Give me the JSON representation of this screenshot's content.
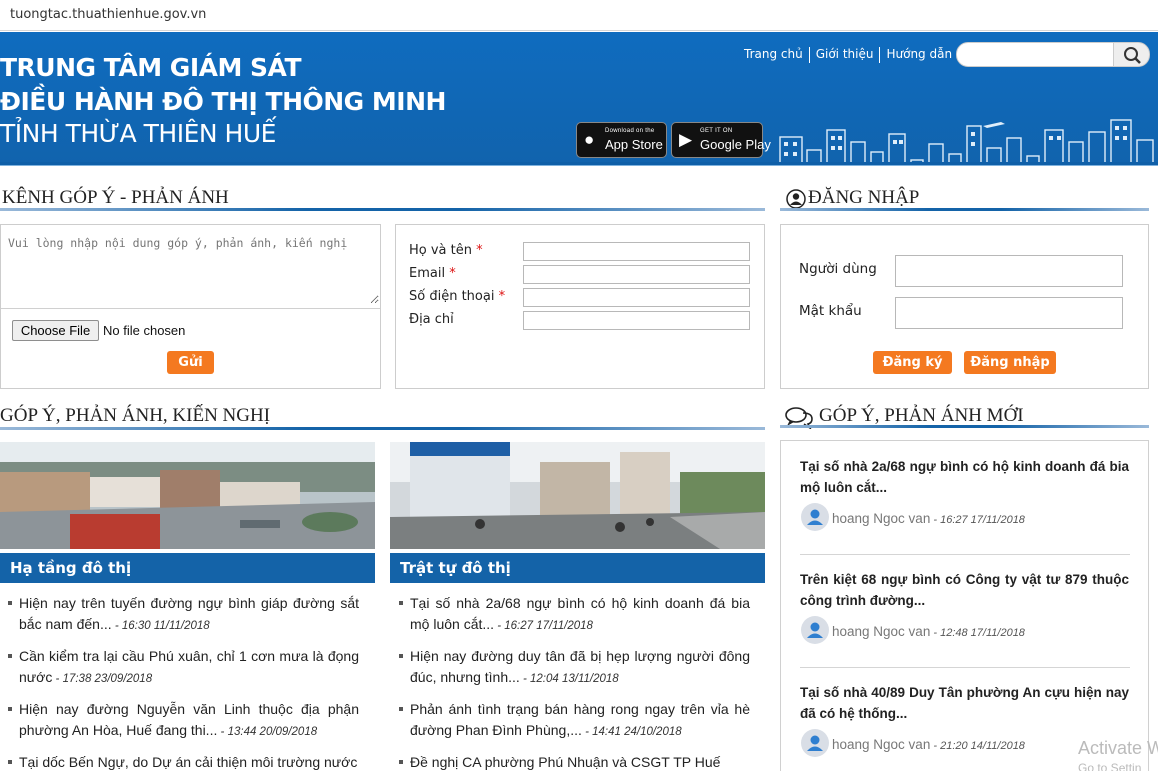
{
  "browser": {
    "url": "tuongtac.thuathienhue.gov.vn"
  },
  "header": {
    "title_line1": "TRUNG TÂM GIÁM SÁT",
    "title_line2": "ĐIỀU HÀNH ĐÔ THỊ THÔNG MINH",
    "title_line3": "TỈNH THỪA THIÊN HUẾ",
    "nav": [
      "Trang chủ",
      "Giới thiệu",
      "Hướng dẫn"
    ],
    "search_placeholder": "",
    "appstore_small": "Download on the",
    "appstore_big": "App Store",
    "gplay_small": "GET IT ON",
    "gplay_big": "Google Play"
  },
  "feedback": {
    "section_title": "KÊNH GÓP Ý - PHẢN ÁNH",
    "textarea_placeholder": "Vui lòng nhập nội dung góp ý, phản ánh, kiến nghị",
    "choose_file": "Choose File",
    "no_file": "No file chosen",
    "send": "Gửi",
    "fields": [
      {
        "label": "Họ và tên",
        "required": "*"
      },
      {
        "label": "Email",
        "required": "*"
      },
      {
        "label": "Số điện thoại",
        "required": "*"
      },
      {
        "label": "Địa chỉ",
        "required": ""
      }
    ]
  },
  "login": {
    "section_title": "ĐĂNG NHẬP",
    "user_label": "Người dùng",
    "pass_label": "Mật khẩu",
    "register": "Đăng ký",
    "login": "Đăng nhập"
  },
  "categories": {
    "section_title": "GÓP Ý, PHẢN ÁNH, KIẾN NGHỊ",
    "col1": {
      "title": "Hạ tầng đô thị",
      "items": [
        {
          "text": "Hiện nay trên tuyến đường ngự bình giáp đường sắt bắc nam đến...",
          "time": " - 16:30 11/11/2018"
        },
        {
          "text": "Cần kiểm tra lại cầu Phú xuân, chỉ 1 cơn mưa là đọng nước",
          "time": " - 17:38 23/09/2018"
        },
        {
          "text": "Hiện nay đường Nguyễn văn Linh thuộc địa phận phường An Hòa, Huế đang thi...",
          "time": " - 13:44 20/09/2018"
        },
        {
          "text": "Tại dốc Bến Ngự, do Dự án cải thiện môi trường nước",
          "time": ""
        }
      ]
    },
    "col2": {
      "title": "Trật tự đô thị",
      "items": [
        {
          "text": "Tại số nhà 2a/68 ngự bình có hộ kinh doanh đá bia mộ luôn cắt...",
          "time": " - 16:27 17/11/2018"
        },
        {
          "text": "Hiện nay đường duy tân đã bị hẹp lượng người đông đúc, nhưng tình...",
          "time": " - 12:04 13/11/2018"
        },
        {
          "text": "Phản ánh tình trạng bán hàng rong ngay trên vỉa hè đường Phan Đình Phùng,...",
          "time": " - 14:41 24/10/2018"
        },
        {
          "text": "Đề nghị CA phường Phú Nhuận và CSGT TP Huế",
          "time": ""
        }
      ]
    }
  },
  "newest": {
    "section_title": "GÓP Ý, PHẢN ÁNH MỚI",
    "items": [
      {
        "title": "Tại số nhà 2a/68 ngự bình có hộ kinh doanh đá bia mộ luôn cắt...",
        "author": "hoang Ngoc van",
        "time": " - 16:27 17/11/2018"
      },
      {
        "title": "Trên kiệt 68 ngự bình có Công ty vật tư 879 thuộc công trình đường...",
        "author": "hoang Ngoc van",
        "time": " - 12:48 17/11/2018"
      },
      {
        "title": "Tại số nhà 40/89 Duy Tân phường An cựu hiện nay đã có hệ thống...",
        "author": "hoang Ngoc van",
        "time": " - 21:20 14/11/2018"
      }
    ]
  },
  "watermark": {
    "line1": "Activate W",
    "line2": "Go to Settin"
  },
  "colors": {
    "header_blue": "#0f6cbf",
    "accent_orange": "#f47920",
    "bar_blue": "#1463a8"
  }
}
